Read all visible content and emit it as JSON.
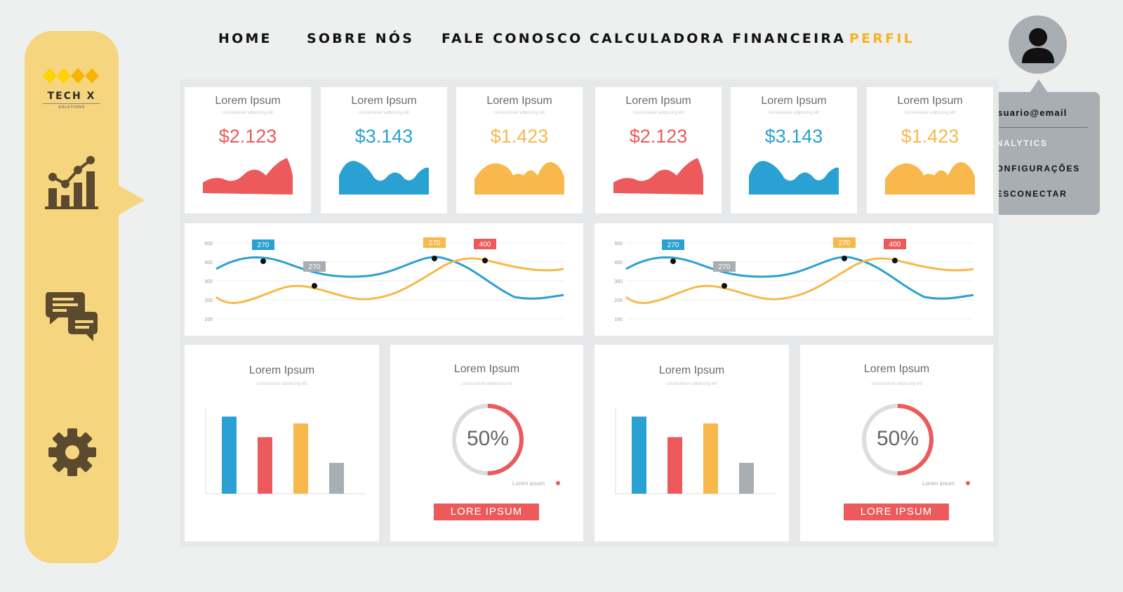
{
  "brand": {
    "name": "TECH X",
    "tagline": "SOLUTIONS"
  },
  "colors": {
    "sidebar": "#f6d57f",
    "accent": "#f5b324",
    "red": "#ec5a5b",
    "blue": "#2aa1d3",
    "yellow": "#f8b84b",
    "gray": "#a9aeb3"
  },
  "sidebar": {
    "items": [
      {
        "icon": "analytics-chart-icon"
      },
      {
        "icon": "chat-icon"
      },
      {
        "icon": "gear-icon"
      }
    ]
  },
  "nav": {
    "items": [
      {
        "label": "HOME"
      },
      {
        "label": "SOBRE NÓS"
      },
      {
        "label": "FALE CONOSCO"
      },
      {
        "label": "CALCULADORA FINANCEIRA"
      },
      {
        "label": "PERFIL",
        "active": true
      }
    ]
  },
  "profile_menu": {
    "email": "usuario@email",
    "items": [
      {
        "label": "ANALYTICS"
      },
      {
        "label": "CONFIGURAÇÕES"
      },
      {
        "label": "DESCONECTAR"
      }
    ]
  },
  "stat_cards": [
    {
      "title": "Lorem Ipsum",
      "subtitle": "consectetuer adipiscing elit",
      "value": "$2.123",
      "color": "#ec5a5b"
    },
    {
      "title": "Lorem Ipsum",
      "subtitle": "consectetuer adipiscing elit",
      "value": "$3.143",
      "color": "#2aa1d3"
    },
    {
      "title": "Lorem Ipsum",
      "subtitle": "consectetuer adipiscing elit",
      "value": "$1.423",
      "color": "#f8b84b"
    },
    {
      "title": "Lorem Ipsum",
      "subtitle": "consectetuer adipiscing elit",
      "value": "$2.123",
      "color": "#ec5a5b"
    },
    {
      "title": "Lorem Ipsum",
      "subtitle": "consectetuer adipiscing elit",
      "value": "$3.143",
      "color": "#2aa1d3"
    },
    {
      "title": "Lorem Ipsum",
      "subtitle": "consectetuer adipiscing elit",
      "value": "$1.423",
      "color": "#f8b84b"
    }
  ],
  "line_chart": {
    "y_ticks": [
      "500",
      "400",
      "300",
      "200",
      "100"
    ],
    "callouts": [
      {
        "label": "270",
        "color": "#2aa1d3"
      },
      {
        "label": "270",
        "color": "#a9aeb3"
      },
      {
        "label": "270",
        "color": "#f8b84b"
      },
      {
        "label": "400",
        "color": "#ec5a5b"
      }
    ]
  },
  "bar_cards": [
    {
      "title": "Lorem Ipsum",
      "subtitle": "consectetuer adipiscing elit"
    },
    {
      "title": "Lorem Ipsum",
      "subtitle": "consectetuer adipiscing elit"
    }
  ],
  "bar_chart": {
    "values": [
      45,
      33,
      41,
      18
    ],
    "colors": [
      "#2aa1d3",
      "#ec5a5b",
      "#f8b84b",
      "#a9aeb3"
    ],
    "ylim": [
      0,
      50
    ]
  },
  "donut_cards": [
    {
      "title": "Lorem Ipsum",
      "subtitle": "consectetuer adipiscing elit",
      "percent": "50%",
      "legend": "Lorem ipsum",
      "button": "LORE IPSUM"
    },
    {
      "title": "Lorem Ipsum",
      "subtitle": "consectetuer adipiscing elit",
      "percent": "50%",
      "legend": "Lorem ipsum",
      "button": "LORE IPSUM"
    }
  ],
  "donut_fraction": 0.5
}
